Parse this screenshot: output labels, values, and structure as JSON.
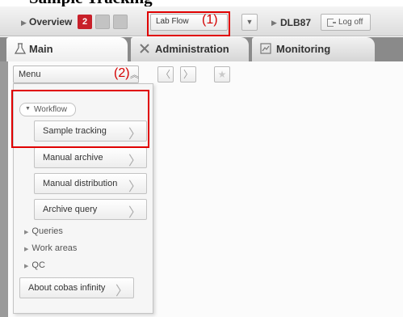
{
  "caption": "Sample Tracking",
  "topbar": {
    "overview_label": "Overview",
    "overview_badge": "2",
    "lab_flow": "Lab Flow",
    "annotation_1": "(1)",
    "dlb": "DLB87",
    "logoff": "Log off"
  },
  "tabs": [
    {
      "label": "Main"
    },
    {
      "label": "Administration"
    },
    {
      "label": "Monitoring"
    }
  ],
  "menu": {
    "header_label": "Menu",
    "annotation_2": "(2)",
    "workflow_label": "Workflow",
    "workflow_items": [
      {
        "label": "Sample tracking"
      },
      {
        "label": "Manual archive"
      },
      {
        "label": "Manual distribution"
      },
      {
        "label": "Archive query"
      }
    ],
    "groups": [
      {
        "label": "Queries"
      },
      {
        "label": "Work areas"
      },
      {
        "label": "QC"
      }
    ],
    "about_label": "About cobas infinity"
  },
  "colors": {
    "badge_red": "#c8202a",
    "annotation_red": "#e00000"
  }
}
